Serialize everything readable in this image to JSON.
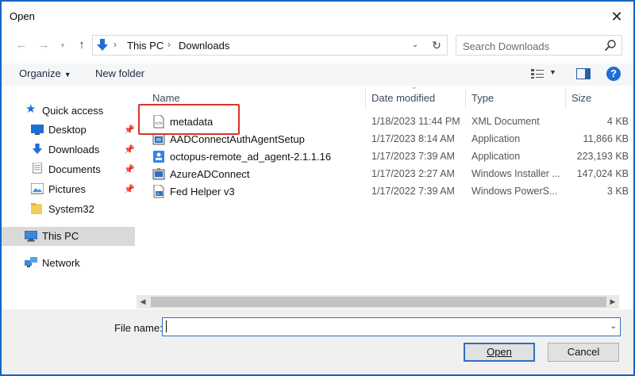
{
  "window": {
    "title": "Open"
  },
  "address": {
    "crumbs": [
      "This PC",
      "Downloads"
    ],
    "separator": ">"
  },
  "search": {
    "placeholder": "Search Downloads"
  },
  "toolbar": {
    "organize_label": "Organize",
    "new_folder_label": "New folder",
    "help_label": "?"
  },
  "nav": {
    "items": [
      {
        "label": "Quick access"
      },
      {
        "label": "Desktop"
      },
      {
        "label": "Downloads"
      },
      {
        "label": "Documents"
      },
      {
        "label": "Pictures"
      },
      {
        "label": "System32"
      },
      {
        "label": "This PC"
      },
      {
        "label": "Network"
      }
    ]
  },
  "columns": {
    "name": "Name",
    "date": "Date modified",
    "type": "Type",
    "size": "Size"
  },
  "files": [
    {
      "name": "metadata",
      "date": "1/18/2023 11:44 PM",
      "type": "XML Document",
      "size": "4 KB",
      "icon": "xml-document-icon"
    },
    {
      "name": "AADConnectAuthAgentSetup",
      "date": "1/17/2023 8:14 AM",
      "type": "Application",
      "size": "11,866 KB",
      "icon": "setup-application-icon"
    },
    {
      "name": "octopus-remote_ad_agent-2.1.1.16",
      "date": "1/17/2023 7:39 AM",
      "type": "Application",
      "size": "223,193 KB",
      "icon": "application-icon"
    },
    {
      "name": "AzureADConnect",
      "date": "1/17/2023 2:27 AM",
      "type": "Windows Installer ...",
      "size": "147,024 KB",
      "icon": "installer-icon"
    },
    {
      "name": "Fed Helper v3",
      "date": "1/17/2022 7:39 AM",
      "type": "Windows PowerS...",
      "size": "3 KB",
      "icon": "powershell-script-icon"
    }
  ],
  "bottom": {
    "file_name_label": "File name:",
    "file_name_value": "",
    "open_label": "Open",
    "cancel_label": "Cancel"
  },
  "colors": {
    "accent": "#1565c0",
    "highlight": "#d9342b",
    "selection": "#d9d9d9"
  }
}
